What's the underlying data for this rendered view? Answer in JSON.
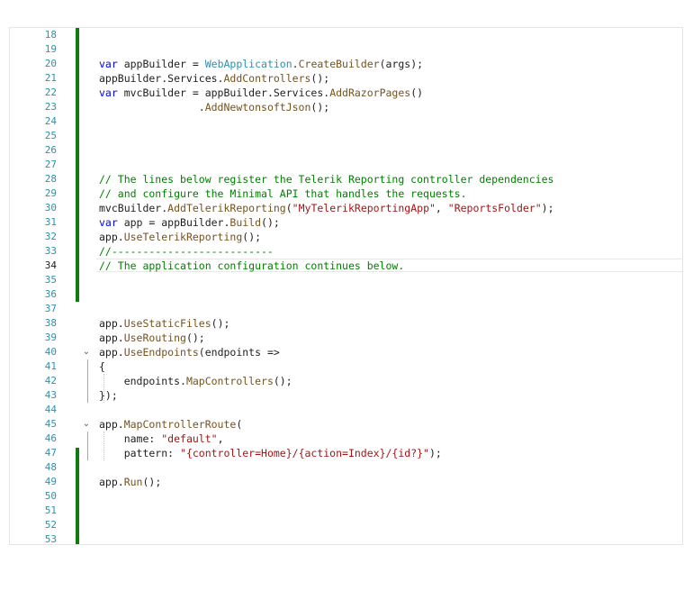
{
  "editor": {
    "current_line": 34,
    "lines": [
      {
        "n": 18,
        "tokens": []
      },
      {
        "n": 19,
        "tokens": []
      },
      {
        "n": 20,
        "tokens": [
          {
            "c": "kw",
            "t": "var"
          },
          {
            "c": "plain",
            "t": " appBuilder = "
          },
          {
            "c": "type",
            "t": "WebApplication"
          },
          {
            "c": "plain",
            "t": "."
          },
          {
            "c": "meth",
            "t": "CreateBuilder"
          },
          {
            "c": "plain",
            "t": "(args);"
          }
        ]
      },
      {
        "n": 21,
        "tokens": [
          {
            "c": "plain",
            "t": "appBuilder.Services."
          },
          {
            "c": "meth",
            "t": "AddControllers"
          },
          {
            "c": "plain",
            "t": "();"
          }
        ]
      },
      {
        "n": 22,
        "tokens": [
          {
            "c": "kw",
            "t": "var"
          },
          {
            "c": "plain",
            "t": " mvcBuilder = appBuilder.Services."
          },
          {
            "c": "meth",
            "t": "AddRazorPages"
          },
          {
            "c": "plain",
            "t": "()"
          }
        ]
      },
      {
        "n": 23,
        "tokens": [
          {
            "c": "plain",
            "t": "                ."
          },
          {
            "c": "meth",
            "t": "AddNewtonsoftJson"
          },
          {
            "c": "plain",
            "t": "();"
          }
        ]
      },
      {
        "n": 24,
        "tokens": []
      },
      {
        "n": 25,
        "tokens": []
      },
      {
        "n": 26,
        "tokens": []
      },
      {
        "n": 27,
        "tokens": []
      },
      {
        "n": 28,
        "tokens": [
          {
            "c": "com",
            "t": "// The lines below register the Telerik Reporting controller dependencies"
          }
        ]
      },
      {
        "n": 29,
        "tokens": [
          {
            "c": "com",
            "t": "// and configure the Minimal API that handles the requests."
          }
        ]
      },
      {
        "n": 30,
        "tokens": [
          {
            "c": "plain",
            "t": "mvcBuilder."
          },
          {
            "c": "meth",
            "t": "AddTelerikReporting"
          },
          {
            "c": "plain",
            "t": "("
          },
          {
            "c": "str",
            "t": "\"MyTelerikReportingApp\""
          },
          {
            "c": "plain",
            "t": ", "
          },
          {
            "c": "str",
            "t": "\"ReportsFolder\""
          },
          {
            "c": "plain",
            "t": ");"
          }
        ]
      },
      {
        "n": 31,
        "tokens": [
          {
            "c": "kw",
            "t": "var"
          },
          {
            "c": "plain",
            "t": " app = appBuilder."
          },
          {
            "c": "meth",
            "t": "Build"
          },
          {
            "c": "plain",
            "t": "();"
          }
        ]
      },
      {
        "n": 32,
        "tokens": [
          {
            "c": "plain",
            "t": "app."
          },
          {
            "c": "meth",
            "t": "UseTelerikReporting"
          },
          {
            "c": "plain",
            "t": "();"
          }
        ]
      },
      {
        "n": 33,
        "tokens": [
          {
            "c": "com",
            "t": "//--------------------------"
          }
        ]
      },
      {
        "n": 34,
        "tokens": [
          {
            "c": "com",
            "t": "// The application configuration continues below."
          }
        ]
      },
      {
        "n": 35,
        "tokens": []
      },
      {
        "n": 36,
        "tokens": []
      },
      {
        "n": 37,
        "tokens": []
      },
      {
        "n": 38,
        "tokens": [
          {
            "c": "plain",
            "t": "app."
          },
          {
            "c": "meth",
            "t": "UseStaticFiles"
          },
          {
            "c": "plain",
            "t": "();"
          }
        ]
      },
      {
        "n": 39,
        "tokens": [
          {
            "c": "plain",
            "t": "app."
          },
          {
            "c": "meth",
            "t": "UseRouting"
          },
          {
            "c": "plain",
            "t": "();"
          }
        ]
      },
      {
        "n": 40,
        "fold": "⌄",
        "tokens": [
          {
            "c": "plain",
            "t": "app."
          },
          {
            "c": "meth",
            "t": "UseEndpoints"
          },
          {
            "c": "plain",
            "t": "(endpoints =>"
          }
        ]
      },
      {
        "n": 41,
        "tokens": [
          {
            "c": "plain",
            "t": "{"
          }
        ]
      },
      {
        "n": 42,
        "tokens": [
          {
            "c": "plain",
            "t": "    endpoints."
          },
          {
            "c": "meth",
            "t": "MapControllers"
          },
          {
            "c": "plain",
            "t": "();"
          }
        ]
      },
      {
        "n": 43,
        "tokens": [
          {
            "c": "plain",
            "t": "});"
          }
        ]
      },
      {
        "n": 44,
        "tokens": []
      },
      {
        "n": 45,
        "fold": "⌄",
        "tokens": [
          {
            "c": "plain",
            "t": "app."
          },
          {
            "c": "meth",
            "t": "MapControllerRoute"
          },
          {
            "c": "plain",
            "t": "("
          }
        ]
      },
      {
        "n": 46,
        "tokens": [
          {
            "c": "plain",
            "t": "    name: "
          },
          {
            "c": "str",
            "t": "\"default\""
          },
          {
            "c": "plain",
            "t": ","
          }
        ]
      },
      {
        "n": 47,
        "tokens": [
          {
            "c": "plain",
            "t": "    pattern: "
          },
          {
            "c": "str",
            "t": "\"{controller=Home}/{action=Index}/{id?}\""
          },
          {
            "c": "plain",
            "t": ");"
          }
        ]
      },
      {
        "n": 48,
        "tokens": []
      },
      {
        "n": 49,
        "tokens": [
          {
            "c": "plain",
            "t": "app."
          },
          {
            "c": "meth",
            "t": "Run"
          },
          {
            "c": "plain",
            "t": "();"
          }
        ]
      },
      {
        "n": 50,
        "tokens": []
      },
      {
        "n": 51,
        "tokens": []
      },
      {
        "n": 52,
        "tokens": []
      },
      {
        "n": 53,
        "tokens": []
      }
    ]
  },
  "colors": {
    "keyword": "#0000ff",
    "type": "#2b91af",
    "string": "#a31515",
    "comment": "#008000",
    "method": "#74531f",
    "change_bar": "#107c10",
    "line_number": "#2b91af"
  }
}
